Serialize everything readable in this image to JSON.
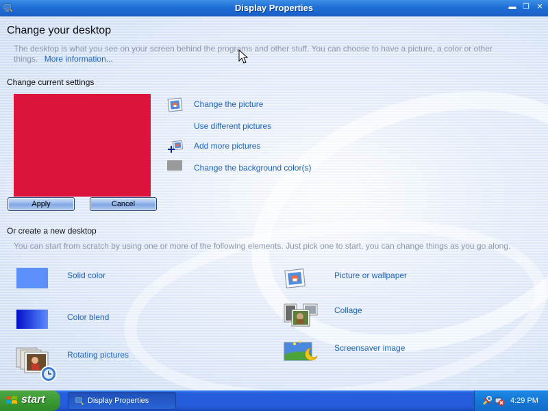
{
  "window": {
    "title": "Display Properties",
    "min_glyph": "▬",
    "max_glyph": "❐",
    "close_glyph": "✕"
  },
  "main": {
    "heading": "Change your desktop",
    "intro": "The desktop is what you see on your screen behind the programs and other stuff. You can choose to have a picture, a color or other things.",
    "more_info": "More information..."
  },
  "current": {
    "title": "Change current settings",
    "preview_color": "#DC143C",
    "apply": "Apply",
    "cancel": "Cancel",
    "links": {
      "change_picture": "Change the picture",
      "different_pictures": "Use different pictures",
      "add_more": "Add more pictures",
      "bg_color": "Change the background color(s)"
    }
  },
  "create": {
    "title": "Or create a new desktop",
    "subtitle": "You can start from scratch by using one or more of the following elements. Just pick one to start, you can change things as you go along.",
    "options": {
      "solid": "Solid color",
      "blend": "Color blend",
      "rotating": "Rotating pictures",
      "wallpaper": "Picture or wallpaper",
      "collage": "Collage",
      "screensaver": "Screensaver image"
    }
  },
  "taskbar": {
    "start": "start",
    "task": "Display Properties",
    "clock": "4:29 PM"
  },
  "colors": {
    "link": "#1A63C6",
    "solid_swatch": "#5B8FF9",
    "blend_from": "#0010C8",
    "blend_to": "#5C8CFF"
  }
}
